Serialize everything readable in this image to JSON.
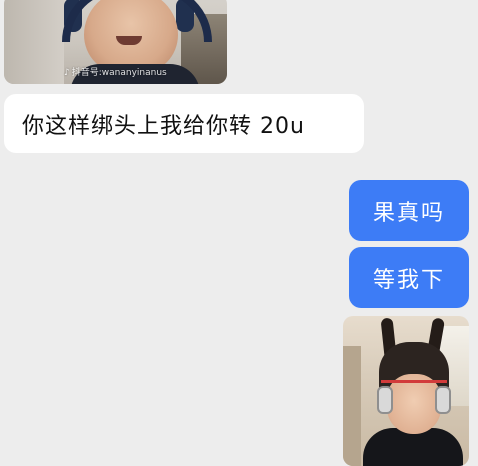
{
  "chat": {
    "incoming_media": {
      "watermark_platform": "抖音号:",
      "watermark_id": "wananyinanus"
    },
    "incoming_message": "你这样绑头上我给你转 20u",
    "outgoing_messages": [
      "果真吗",
      "等我下"
    ],
    "colors": {
      "background": "#ededed",
      "incoming_bubble": "#ffffff",
      "outgoing_bubble": "#3d7cf6"
    }
  }
}
